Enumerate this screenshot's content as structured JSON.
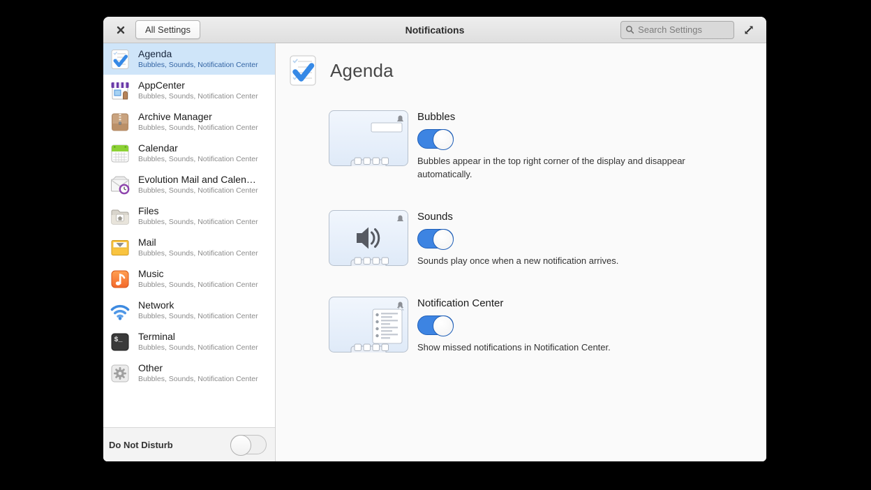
{
  "window": {
    "title": "Notifications",
    "all_settings_button": "All Settings",
    "search": {
      "placeholder": "Search Settings"
    }
  },
  "colors": {
    "accent": "#3689e6",
    "selected_item_bg": "#cfe5f9",
    "selected_subtitle": "#3465a4",
    "titlebar_bg": "#e8e8e8",
    "window_bg": "#fafafa"
  },
  "sidebar": {
    "items": [
      {
        "name": "Agenda",
        "subtitle": "Bubbles, Sounds, Notification Center",
        "icon": "agenda-app-icon",
        "selected": true
      },
      {
        "name": "AppCenter",
        "subtitle": "Bubbles, Sounds, Notification Center",
        "icon": "appcenter-app-icon"
      },
      {
        "name": "Archive Manager",
        "subtitle": "Bubbles, Sounds, Notification Center",
        "icon": "archive-manager-app-icon"
      },
      {
        "name": "Calendar",
        "subtitle": "Bubbles, Sounds, Notification Center",
        "icon": "calendar-app-icon"
      },
      {
        "name": "Evolution Mail and Calen…",
        "subtitle": "Bubbles, Sounds, Notification Center",
        "icon": "evolution-app-icon"
      },
      {
        "name": "Files",
        "subtitle": "Bubbles, Sounds, Notification Center",
        "icon": "files-app-icon"
      },
      {
        "name": "Mail",
        "subtitle": "Bubbles, Sounds, Notification Center",
        "icon": "mail-app-icon"
      },
      {
        "name": "Music",
        "subtitle": "Bubbles, Sounds, Notification Center",
        "icon": "music-app-icon"
      },
      {
        "name": "Network",
        "subtitle": "Bubbles, Sounds, Notification Center",
        "icon": "network-app-icon"
      },
      {
        "name": "Terminal",
        "subtitle": "Bubbles, Sounds, Notification Center",
        "icon": "terminal-app-icon"
      },
      {
        "name": "Other",
        "subtitle": "Bubbles, Sounds, Notification Center",
        "icon": "other-app-icon"
      }
    ],
    "footer": {
      "label": "Do Not Disturb",
      "toggle": "off"
    }
  },
  "main": {
    "app_title": "Agenda",
    "app_icon": "agenda-app-icon",
    "sections": [
      {
        "title": "Bubbles",
        "toggle": "on",
        "illustration": "bubbles-illustration",
        "description": "Bubbles appear in the top right corner of the display and disappear automatically."
      },
      {
        "title": "Sounds",
        "toggle": "on",
        "illustration": "sounds-illustration",
        "description": "Sounds play once when a new notification arrives."
      },
      {
        "title": "Notification Center",
        "toggle": "on",
        "illustration": "notification-center-illustration",
        "description": "Show missed notifications in Notification Center."
      }
    ]
  }
}
